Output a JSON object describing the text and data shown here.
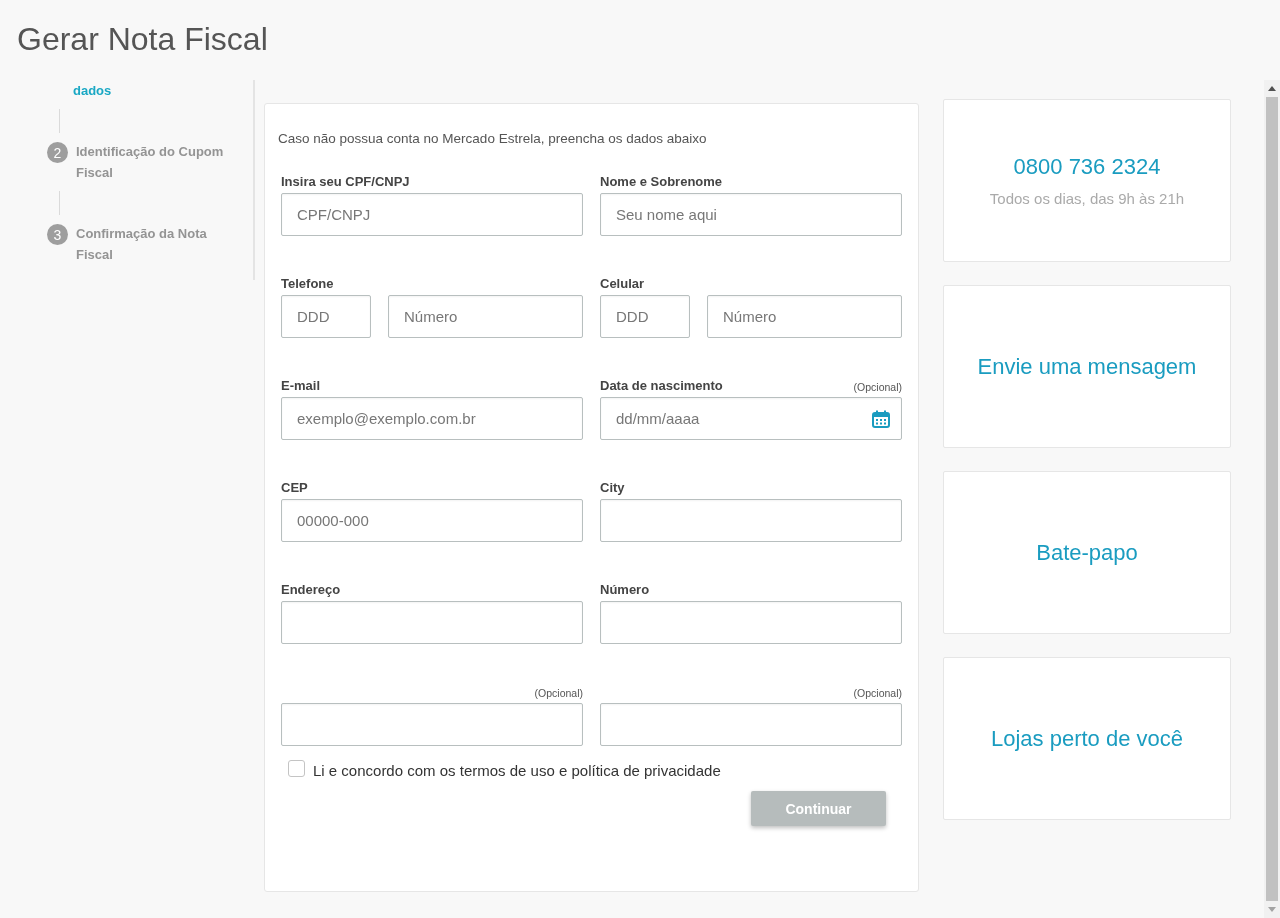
{
  "page_title": "Gerar Nota Fiscal",
  "steps": [
    {
      "label": "dados",
      "selected": true
    },
    {
      "number": "2",
      "label": "Identificação do Cupom Fiscal",
      "selected": false
    },
    {
      "number": "3",
      "label": "Confirmação da Nota Fiscal",
      "selected": false
    }
  ],
  "form": {
    "intro": "Caso não possua conta no Mercado Estrela, preencha os dados abaixo",
    "rows": [
      [
        {
          "label": "Insira seu CPF/CNPJ",
          "inputs": [
            {
              "kind": "text",
              "placeholder": "CPF/CNPJ"
            }
          ]
        },
        {
          "label": "Nome e Sobrenome",
          "inputs": [
            {
              "kind": "text",
              "placeholder": "Seu nome aqui"
            }
          ]
        }
      ],
      [
        {
          "label": "Telefone",
          "inputs": [
            {
              "kind": "short",
              "placeholder": "DDD"
            },
            {
              "kind": "text",
              "placeholder": "Número"
            }
          ]
        },
        {
          "label": "Celular",
          "inputs": [
            {
              "kind": "short",
              "placeholder": "DDD"
            },
            {
              "kind": "text",
              "placeholder": "Número"
            }
          ]
        }
      ],
      [
        {
          "label": "E-mail",
          "inputs": [
            {
              "kind": "text",
              "placeholder": "exemplo@exemplo.com.br"
            }
          ]
        },
        {
          "label": "Data de nascimento",
          "optional": "(Opcional)",
          "inputs": [
            {
              "kind": "date",
              "placeholder": "dd/mm/aaaa"
            }
          ]
        }
      ],
      [
        {
          "label": "CEP",
          "inputs": [
            {
              "kind": "text",
              "placeholder": "00000-000"
            }
          ]
        },
        {
          "label": "City",
          "inputs": [
            {
              "kind": "text"
            }
          ]
        }
      ],
      [
        {
          "label": "Endereço",
          "inputs": [
            {
              "kind": "text"
            }
          ]
        },
        {
          "label": "Número",
          "inputs": [
            {
              "kind": "text"
            }
          ]
        }
      ],
      [
        {
          "optional": "(Opcional)",
          "inputs": [
            {
              "kind": "text"
            }
          ]
        },
        {
          "optional": "(Opcional)",
          "inputs": [
            {
              "kind": "text"
            }
          ]
        }
      ]
    ],
    "terms": {
      "label": "Li e concordo com os termos de uso e política de privacidade",
      "checked": false
    },
    "submit": {
      "label": "Continuar",
      "disabled": true
    }
  },
  "contacts": [
    {
      "title": "0800 736 2324",
      "subtitle": "Todos os dias, das 9h às 21h"
    },
    {
      "title": "Envie uma mensagem"
    },
    {
      "title": "Bate-papo"
    },
    {
      "title": "Lojas perto de você"
    }
  ]
}
